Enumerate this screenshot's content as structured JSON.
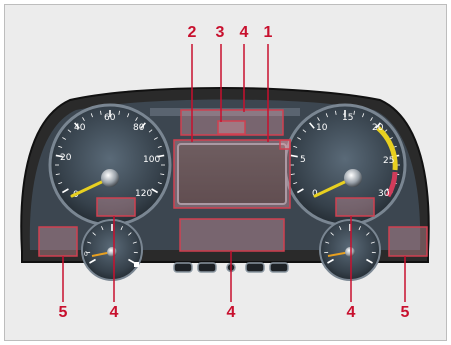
{
  "callouts": [
    {
      "id": "c2-top",
      "label": "2"
    },
    {
      "id": "c3-top",
      "label": "3"
    },
    {
      "id": "c4-top",
      "label": "4"
    },
    {
      "id": "c1-top",
      "label": "1"
    },
    {
      "id": "c5-left",
      "label": "5"
    },
    {
      "id": "c4-left",
      "label": "4"
    },
    {
      "id": "c4-center",
      "label": "4"
    },
    {
      "id": "c4-right",
      "label": "4"
    },
    {
      "id": "c5-right",
      "label": "5"
    }
  ],
  "speedometer": {
    "ticks": [
      "0",
      "20",
      "40",
      "60",
      "80",
      "100",
      "120"
    ]
  },
  "tachometer": {
    "ticks": [
      "0",
      "5",
      "10",
      "15",
      "20",
      "25",
      "30"
    ]
  },
  "small_gauge_left": {
    "ticks": [
      "0"
    ]
  },
  "colors": {
    "callout": "#c8102e",
    "highlight_fill": "#e8a0a8",
    "needle": "#e8d020",
    "cluster_bezel": "#2a2a2a",
    "dial_face": "#3a4550"
  }
}
